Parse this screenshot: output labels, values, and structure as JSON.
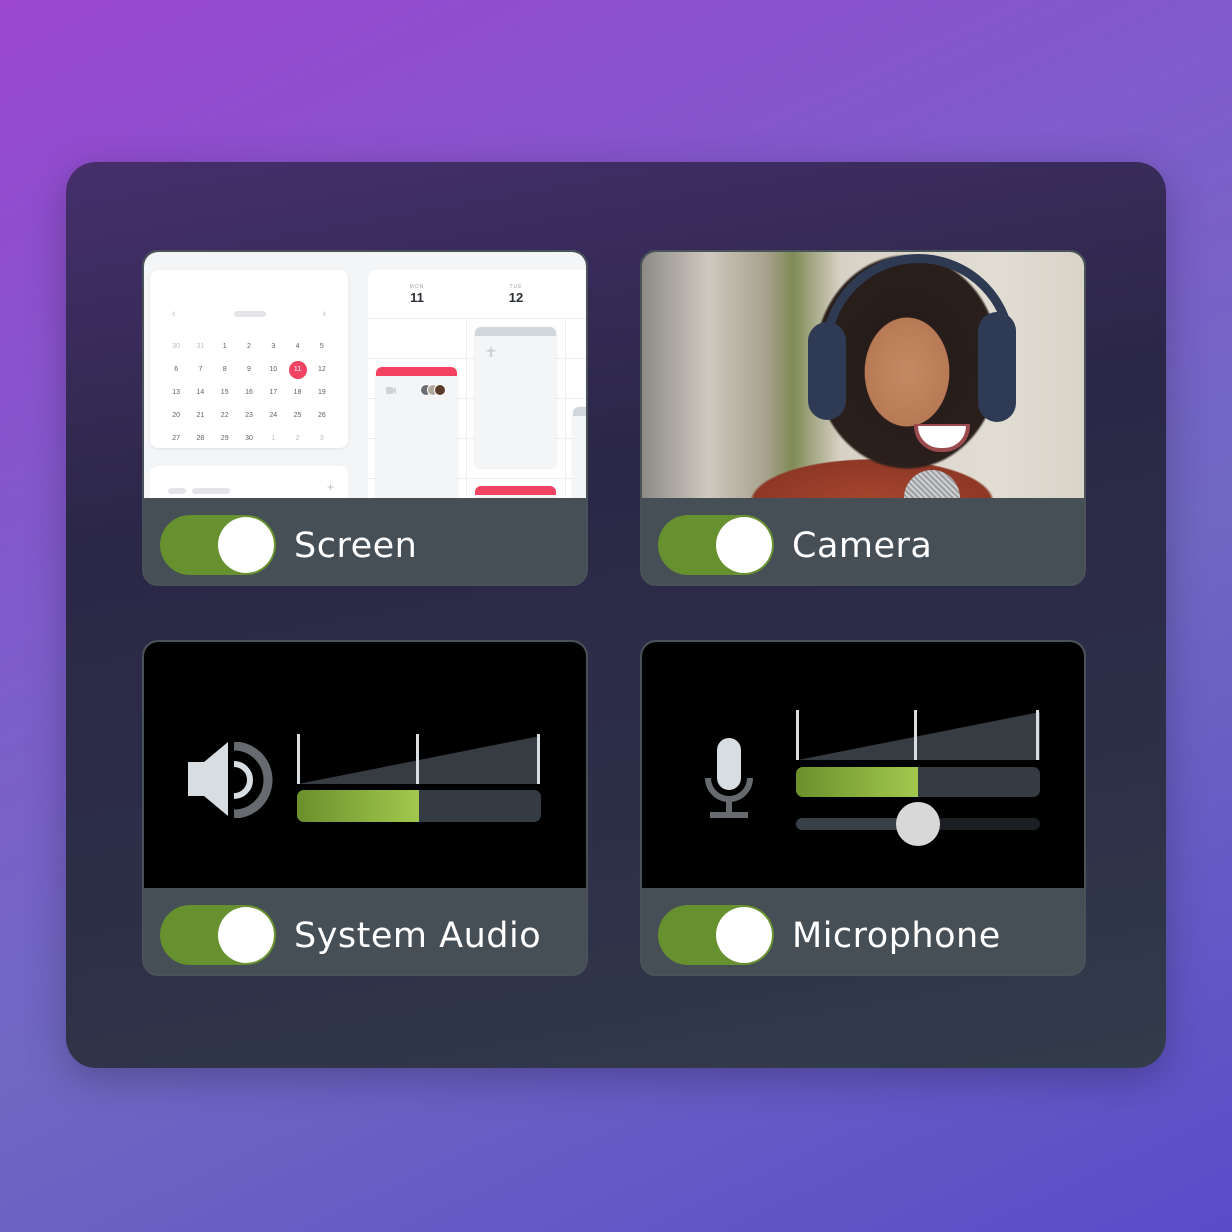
{
  "cards": {
    "screen": {
      "label": "Screen",
      "enabled": true,
      "preview": {
        "calendar": {
          "prev_icon": "‹",
          "next_icon": "›",
          "days": [
            [
              "30",
              "31",
              "1",
              "2",
              "3",
              "4",
              "5"
            ],
            [
              "6",
              "7",
              "8",
              "9",
              "10",
              "11",
              "12"
            ],
            [
              "13",
              "14",
              "15",
              "16",
              "17",
              "18",
              "19"
            ],
            [
              "20",
              "21",
              "22",
              "23",
              "24",
              "25",
              "26"
            ],
            [
              "27",
              "28",
              "29",
              "30",
              "1",
              "2",
              "3"
            ]
          ],
          "selected_day": "11",
          "plus_icon": "+"
        },
        "week": {
          "days": [
            {
              "name": "MON",
              "date": "11"
            },
            {
              "name": "TUE",
              "date": "12"
            }
          ],
          "event_icons": [
            "video-camera-icon",
            "airplane-icon"
          ]
        }
      }
    },
    "camera": {
      "label": "Camera",
      "enabled": true
    },
    "system_audio": {
      "label": "System Audio",
      "enabled": true,
      "icon": "speaker-icon",
      "level_percent": 50
    },
    "microphone": {
      "label": "Microphone",
      "enabled": true,
      "icon": "microphone-icon",
      "level_percent": 50,
      "gain_percent": 50
    }
  },
  "colors": {
    "toggle_on": "#67902e",
    "meter_start": "#6b902c",
    "meter_end": "#a2c84e",
    "accent_red": "#f24462"
  }
}
